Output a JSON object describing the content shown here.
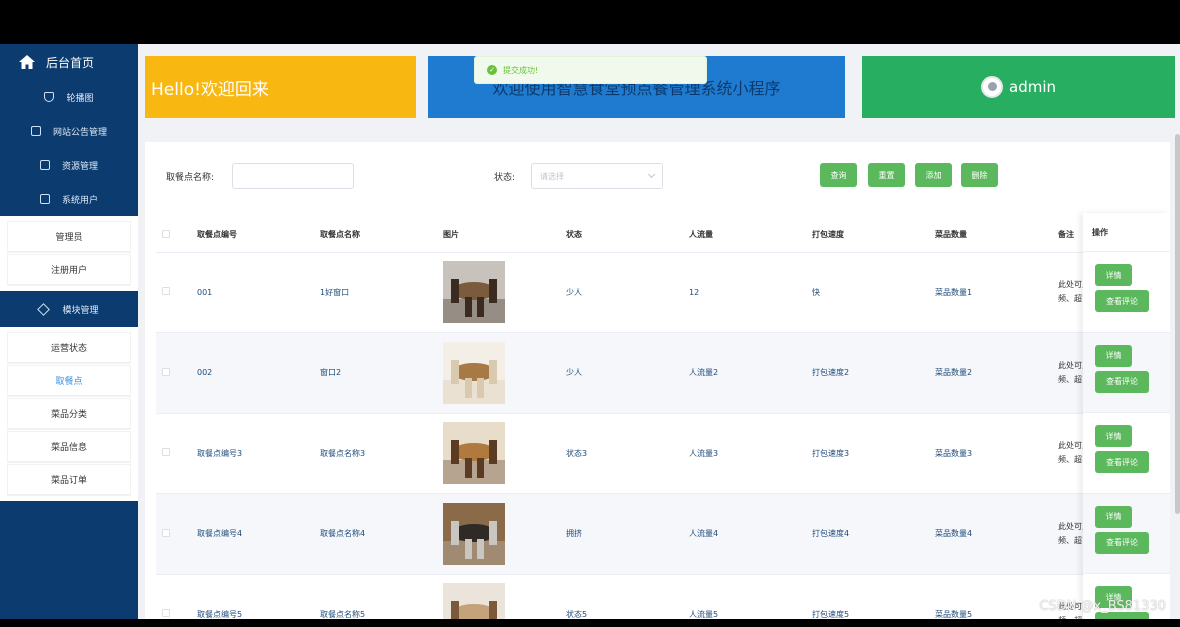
{
  "sidebar": {
    "home": "后台首页",
    "items": [
      {
        "label": "轮播图",
        "icon": "shield-icon"
      },
      {
        "label": "网站公告管理",
        "icon": "edit-icon"
      },
      {
        "label": "资源管理",
        "icon": "resource-icon"
      },
      {
        "label": "系统用户",
        "icon": "chart-icon"
      }
    ],
    "user_sub": [
      "管理员",
      "注册用户"
    ],
    "module": "模块管理",
    "module_sub": [
      "运营状态",
      "取餐点",
      "菜品分类",
      "菜品信息",
      "菜品订单"
    ],
    "active_item": "取餐点"
  },
  "banner": {
    "hello": "Hello!欢迎回来",
    "welcome": "欢迎使用智慧食堂预点餐管理系统小程序",
    "admin": "admin"
  },
  "toast": "提交成功!",
  "filter": {
    "name_label": "取餐点名称:",
    "status_label": "状态:",
    "status_placeholder": "请选择",
    "buttons": [
      "查询",
      "重置",
      "添加",
      "删除"
    ]
  },
  "table": {
    "headers": [
      "取餐点编号",
      "取餐点名称",
      "图片",
      "状态",
      "人流量",
      "打包速度",
      "菜品数量",
      "备注",
      "操作"
    ],
    "rows": [
      {
        "code": "001",
        "name": "1好窗口",
        "status": "少人",
        "flow": "12",
        "speed": "快",
        "count": "菜品数量1",
        "note": [
          "此处可,",
          "频、超"
        ]
      },
      {
        "code": "002",
        "name": "窗口2",
        "status": "少人",
        "flow": "人流量2",
        "speed": "打包速度2",
        "count": "菜品数量2",
        "note": [
          "此处可,",
          "频、超"
        ]
      },
      {
        "code": "取餐点编号3",
        "name": "取餐点名称3",
        "status": "状态3",
        "flow": "人流量3",
        "speed": "打包速度3",
        "count": "菜品数量3",
        "note": [
          "此处可,",
          "频、超"
        ]
      },
      {
        "code": "取餐点编号4",
        "name": "取餐点名称4",
        "status": "拥挤",
        "flow": "人流量4",
        "speed": "打包速度4",
        "count": "菜品数量4",
        "note": [
          "此处可,",
          "频、超"
        ]
      },
      {
        "code": "取餐点编号5",
        "name": "取餐点名称5",
        "status": "状态5",
        "flow": "人流量5",
        "speed": "打包速度5",
        "count": "菜品数量5",
        "note": [
          "此处可,",
          "频、超"
        ]
      }
    ],
    "op_detail": "详情",
    "op_review": "查看评论"
  },
  "watermark": "CSDN @x_BS81330",
  "colors": {
    "sidebar": "#0b3b6f",
    "hello": "#f9b811",
    "welcome": "#1e7bd0",
    "admin": "#27ae60",
    "button": "#5cb85c"
  }
}
